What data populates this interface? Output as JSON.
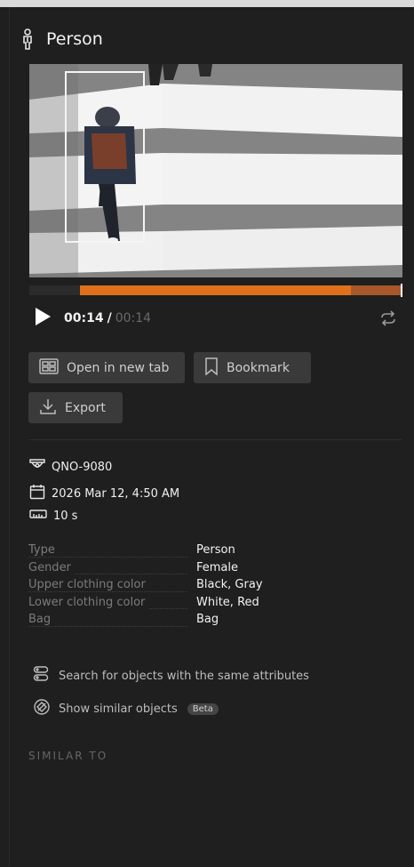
{
  "header": {
    "title": "Person",
    "icon": "person-icon"
  },
  "player": {
    "current_time": "00:14",
    "separator": "/",
    "total_time": "00:14",
    "progress_fraction": 1.0,
    "highlight_colors": {
      "segment": "#e0701c",
      "tail": "#a8582a"
    }
  },
  "actions": {
    "open_new_tab": "Open in new tab",
    "bookmark": "Bookmark",
    "export": "Export"
  },
  "meta": {
    "camera": "QNO-9080",
    "datetime": "2026 Mar 12, 4:50 AM",
    "duration": "10 s"
  },
  "attributes": [
    {
      "key": "Type",
      "value": "Person"
    },
    {
      "key": "Gender",
      "value": "Female"
    },
    {
      "key": "Upper clothing color",
      "value": "Black, Gray"
    },
    {
      "key": "Lower clothing color",
      "value": "White, Red"
    },
    {
      "key": "Bag",
      "value": "Bag"
    }
  ],
  "links": {
    "search_same": "Search for objects with the same attributes",
    "show_similar": "Show similar objects",
    "beta_badge": "Beta"
  },
  "sections": {
    "similar_to": "SIMILAR TO"
  },
  "colors": {
    "accent": "#e0701c",
    "background": "#1f1f1f",
    "button": "#3a3a3a"
  }
}
